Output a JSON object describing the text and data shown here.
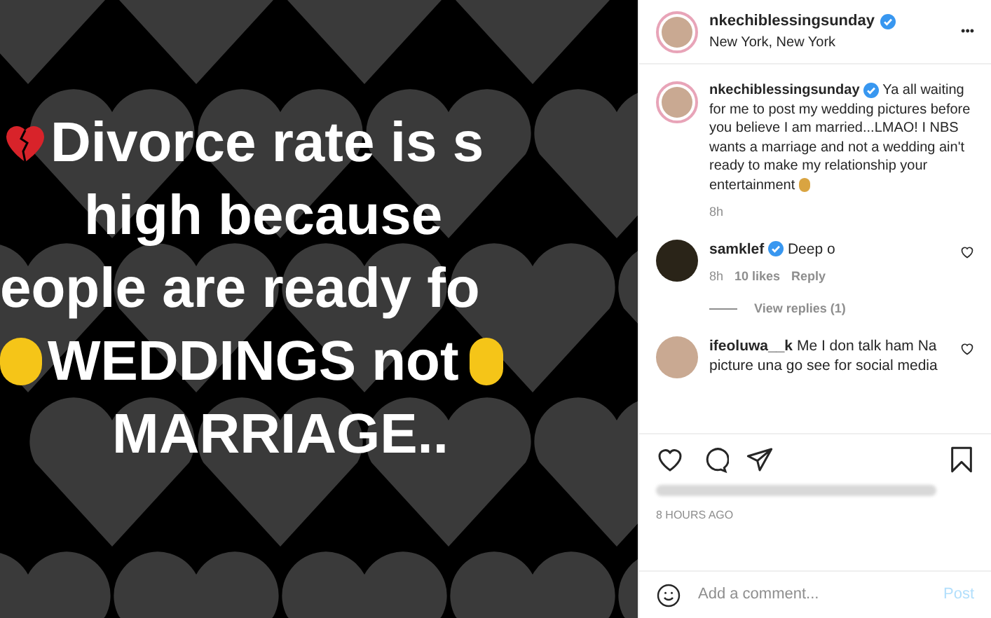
{
  "post_image": {
    "lines": [
      "Divorce rate is s",
      "high because",
      "eople are ready fo",
      "WEDDINGS not",
      "MARRIAGE.."
    ]
  },
  "header": {
    "username": "nkechiblessingsunday",
    "verified": true,
    "location": "New York, New York",
    "more": "•••"
  },
  "caption": {
    "username": "nkechiblessingsunday",
    "verified": true,
    "text": "Ya all waiting for me to post my wedding pictures before you believe I am married...LMAO! I NBS wants a marriage and not a wedding ain't ready to make my relationship your entertainment",
    "time": "8h"
  },
  "comments": [
    {
      "username": "samklef",
      "verified": true,
      "text": "Deep o",
      "time": "8h",
      "likes": "10 likes",
      "reply": "Reply",
      "view_replies": "View replies (1)",
      "liked": false
    },
    {
      "username": "ifeoluwa__k",
      "verified": false,
      "text": "Me I don talk ham Na picture una go see for social media",
      "liked": false
    }
  ],
  "timestamp": "8 HOURS AGO",
  "add_comment": {
    "placeholder": "Add a comment...",
    "post": "Post"
  }
}
